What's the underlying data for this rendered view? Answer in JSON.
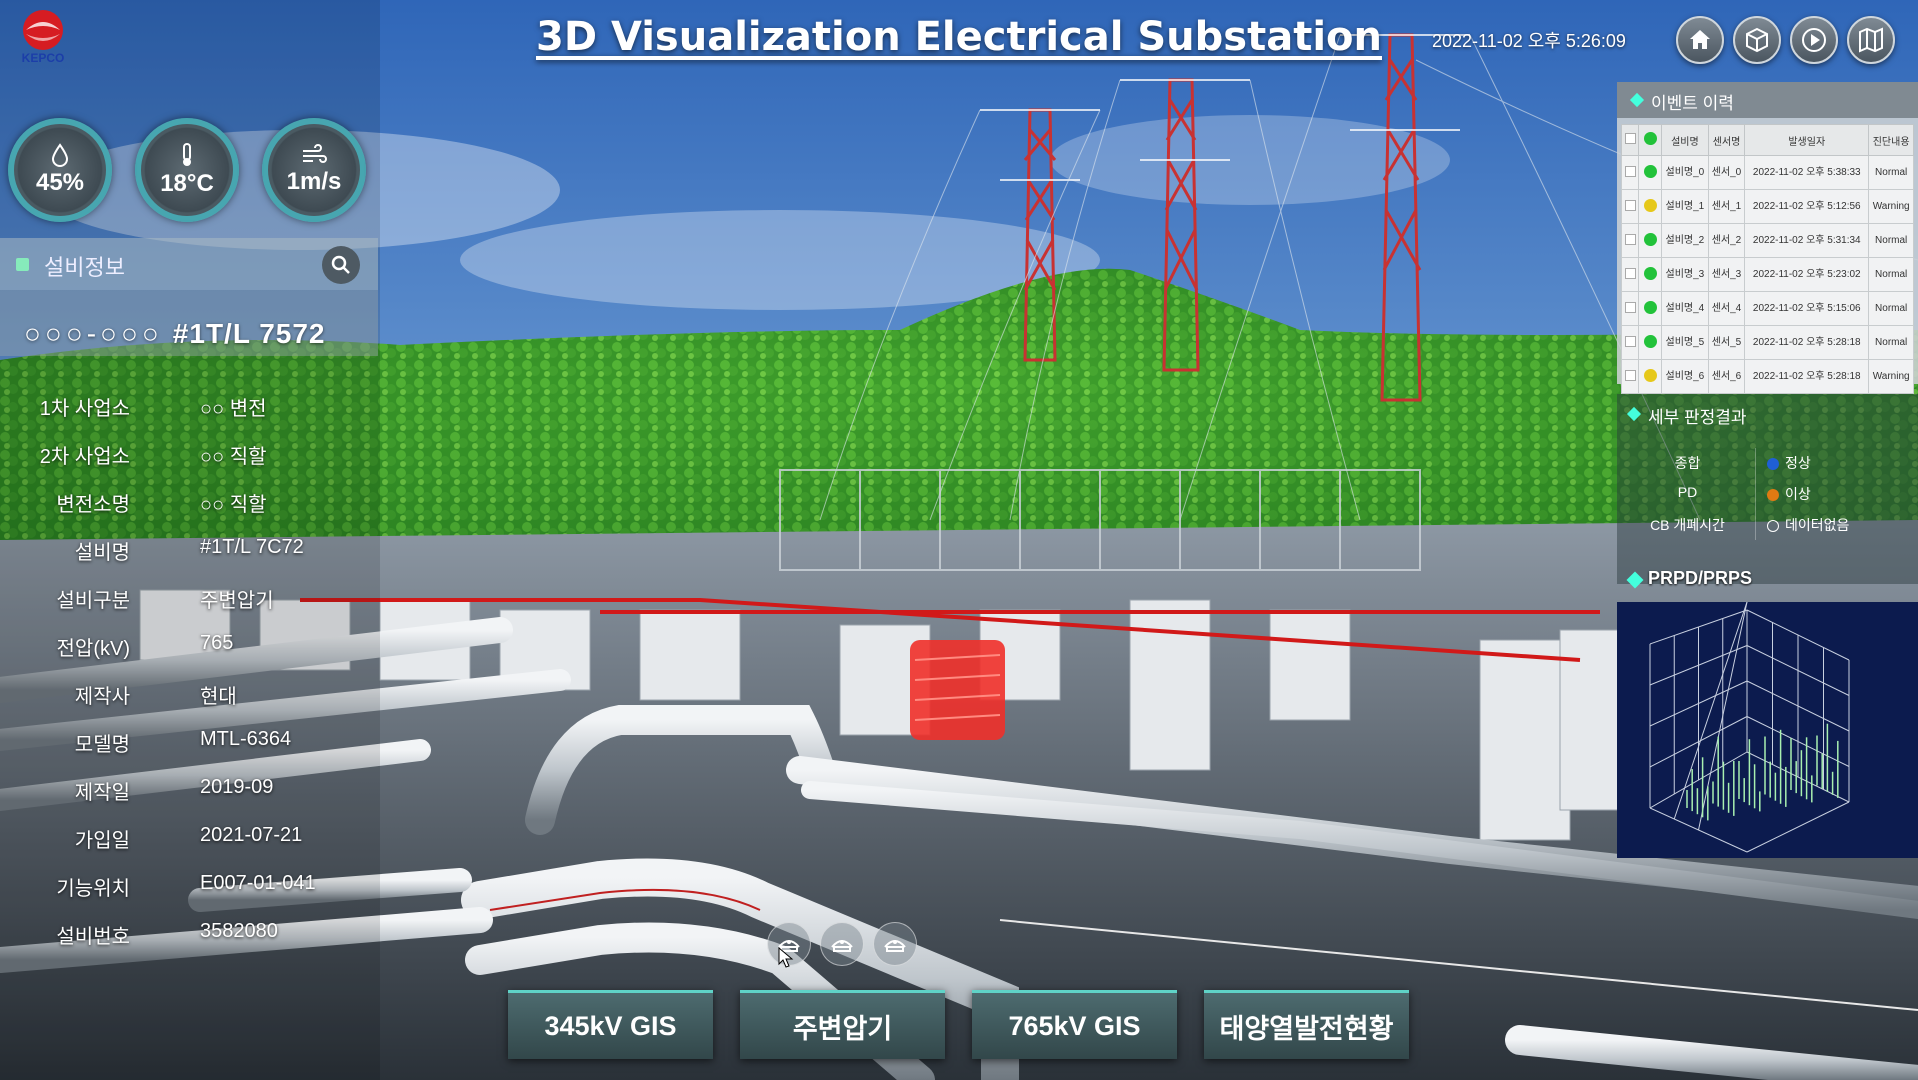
{
  "header": {
    "logo_text": "KEPCO",
    "title": "3D Visualization Electrical Substation",
    "datetime": "2022-11-02 오후 5:26:09",
    "buttons": [
      {
        "icon": "home-icon"
      },
      {
        "icon": "cube-icon"
      },
      {
        "icon": "play-icon"
      },
      {
        "icon": "map-icon"
      }
    ]
  },
  "weather": {
    "humidity": "45%",
    "temperature": "18°C",
    "wind": "1m/s"
  },
  "equipment_info": {
    "section_title": "설비정보",
    "equipment_circles": "○○○-○○○",
    "equipment_id": "#1T/L 7572",
    "rows": [
      {
        "label": "1차 사업소",
        "value": "○○ 변전"
      },
      {
        "label": "2차 사업소",
        "value": "○○ 직할"
      },
      {
        "label": "변전소명",
        "value": "○○ 직할"
      },
      {
        "label": "설비명",
        "value": "#1T/L 7C72"
      },
      {
        "label": "설비구분",
        "value": "주변압기"
      },
      {
        "label": "전압(kV)",
        "value": "765"
      },
      {
        "label": "제작사",
        "value": "현대"
      },
      {
        "label": "모델명",
        "value": "MTL-6364"
      },
      {
        "label": "제작일",
        "value": "2019-09"
      },
      {
        "label": "가입일",
        "value": "2021-07-21"
      },
      {
        "label": "기능위치",
        "value": "E007-01-041"
      },
      {
        "label": "설비번호",
        "value": "3582080"
      }
    ]
  },
  "event_history": {
    "title": "이벤트 이력",
    "columns": [
      "설비명",
      "센서명",
      "발생일자",
      "진단내용"
    ],
    "rows": [
      {
        "status": "#22c23a",
        "equip": "설비명_0",
        "sensor": "센서_0",
        "date": "2022-11-02 오후 5:38:33",
        "diag": "Normal"
      },
      {
        "status": "#e6c81a",
        "equip": "설비명_1",
        "sensor": "센서_1",
        "date": "2022-11-02 오후 5:12:56",
        "diag": "Warning"
      },
      {
        "status": "#22c23a",
        "equip": "설비명_2",
        "sensor": "센서_2",
        "date": "2022-11-02 오후 5:31:34",
        "diag": "Normal"
      },
      {
        "status": "#22c23a",
        "equip": "설비명_3",
        "sensor": "센서_3",
        "date": "2022-11-02 오후 5:23:02",
        "diag": "Normal"
      },
      {
        "status": "#22c23a",
        "equip": "설비명_4",
        "sensor": "센서_4",
        "date": "2022-11-02 오후 5:15:06",
        "diag": "Normal"
      },
      {
        "status": "#22c23a",
        "equip": "설비명_5",
        "sensor": "센서_5",
        "date": "2022-11-02 오후 5:28:18",
        "diag": "Normal"
      },
      {
        "status": "#e6c81a",
        "equip": "설비명_6",
        "sensor": "센서_6",
        "date": "2022-11-02 오후 5:28:18",
        "diag": "Warning"
      }
    ]
  },
  "detail_results": {
    "title": "세부 판정결과",
    "items": [
      {
        "label": "종합",
        "legend": "정상",
        "color": "#1f5fd6"
      },
      {
        "label": "PD",
        "legend": "이상",
        "color": "#e07a12"
      },
      {
        "label": "CB 개폐시간",
        "legend": "데이터없음",
        "color": "none"
      }
    ]
  },
  "prpd": {
    "title": "PRPD/PRPS"
  },
  "bottom_nav": {
    "buttons": [
      "345kV GIS",
      "주변압기",
      "765kV GIS",
      "태양열발전현황"
    ]
  },
  "camera_icons": [
    "camera-icon",
    "camera-icon",
    "camera-icon"
  ]
}
